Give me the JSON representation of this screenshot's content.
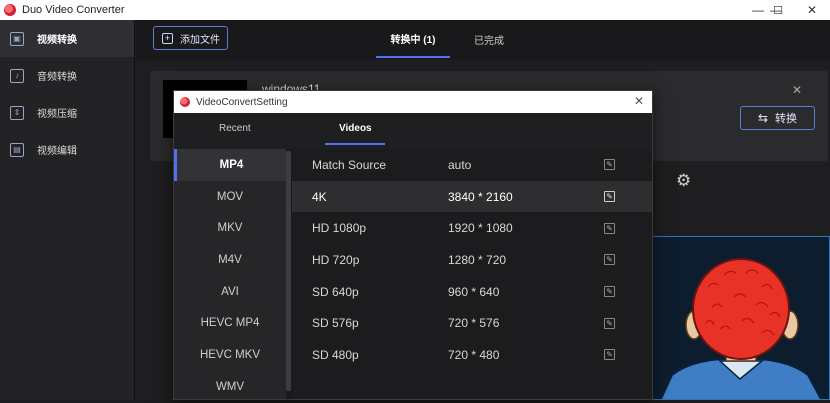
{
  "window": {
    "title": "Duo Video Converter",
    "controls": {
      "minimize": "—",
      "maximize": "☐",
      "close": "✕"
    }
  },
  "sidebar": {
    "items": [
      {
        "label": "视频转换",
        "icon": "video-file-icon",
        "glyph": "▣",
        "active": true
      },
      {
        "label": "音频转换",
        "icon": "audio-file-icon",
        "glyph": "♪",
        "active": false
      },
      {
        "label": "视频压缩",
        "icon": "compress-icon",
        "glyph": "⇕",
        "active": false
      },
      {
        "label": "视频编辑",
        "icon": "edit-video-icon",
        "glyph": "▤",
        "active": false
      }
    ]
  },
  "toolbar": {
    "add_file_label": "添加文件",
    "add_icon": "+",
    "tabs": [
      {
        "label": "转换中 (1)",
        "active": true
      },
      {
        "label": "已完成",
        "active": false
      }
    ]
  },
  "file": {
    "name": "windows11",
    "close_glyph": "✕",
    "convert_label": "转换",
    "convert_icon": "⇆",
    "settings_icon": "⚙"
  },
  "dialog": {
    "title": "VideoConvertSetting",
    "close_glyph": "✕",
    "tabs": [
      {
        "label": "Recent",
        "active": false
      },
      {
        "label": "Videos",
        "active": true
      }
    ],
    "formats": [
      "MP4",
      "MOV",
      "MKV",
      "M4V",
      "AVI",
      "HEVC MP4",
      "HEVC MKV",
      "WMV"
    ],
    "selected_format": "MP4",
    "resolutions": [
      {
        "name": "Match Source",
        "value": "auto"
      },
      {
        "name": "4K",
        "value": "3840 * 2160"
      },
      {
        "name": "HD 1080p",
        "value": "1920 * 1080"
      },
      {
        "name": "HD 720p",
        "value": "1280 * 720"
      },
      {
        "name": "SD 640p",
        "value": "960 * 640"
      },
      {
        "name": "SD 576p",
        "value": "720 * 576"
      },
      {
        "name": "SD 480p",
        "value": "720 * 480"
      }
    ],
    "selected_resolution": "4K",
    "edit_glyph": "✎"
  },
  "colors": {
    "accent": "#5470e8",
    "background": "#1c1c1e",
    "sidebar": "#232326"
  }
}
